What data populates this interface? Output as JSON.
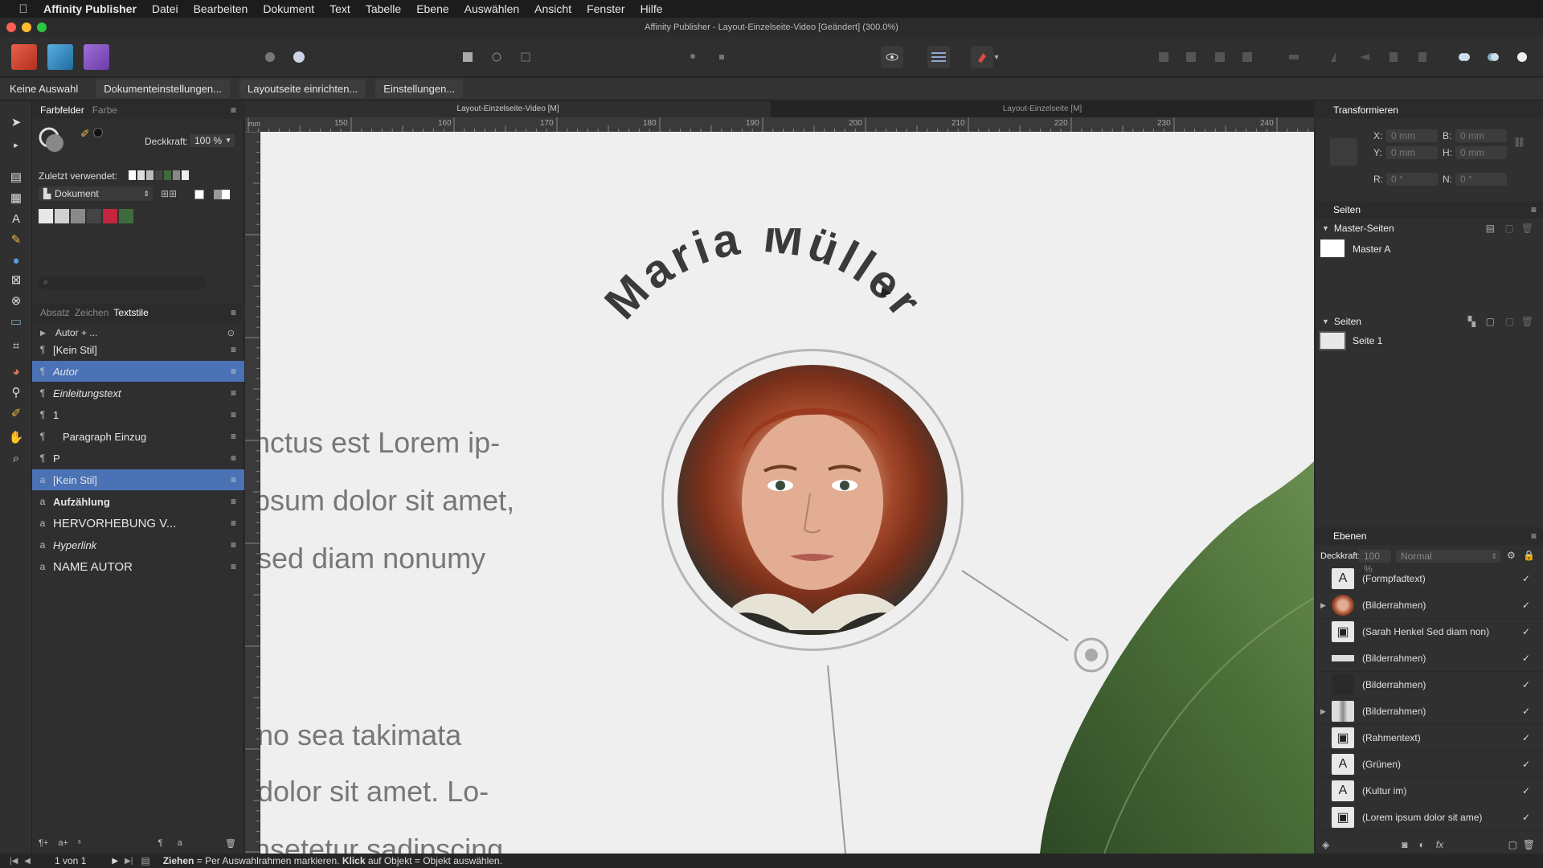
{
  "menubar": {
    "app_name": "Affinity Publisher",
    "items": [
      "Datei",
      "Bearbeiten",
      "Dokument",
      "Text",
      "Tabelle",
      "Ebene",
      "Auswählen",
      "Ansicht",
      "Fenster",
      "Hilfe"
    ]
  },
  "window_title": "Affinity Publisher - Layout-Einzelseite-Video [Geändert] (300.0%)",
  "context_bar": {
    "selection": "Keine Auswahl",
    "doc_settings": "Dokumenteinstellungen...",
    "layout_page": "Layoutseite einrichten...",
    "settings": "Einstellungen..."
  },
  "swatches_panel": {
    "tab_swatches": "Farbfelder",
    "tab_color": "Farbe",
    "opacity_label": "Deckkraft:",
    "opacity_value": "100 %",
    "recent_label": "Zuletzt verwendet:",
    "palette": "Dokument"
  },
  "text_styles_panel": {
    "tab_paragraph": "Absatz",
    "tab_character": "Zeichen",
    "tab_styles": "Textstile",
    "preview": "Autor + ...",
    "styles": [
      {
        "label": "[Kein Stil]",
        "type": "paragraph",
        "selected": false
      },
      {
        "label": "Autor",
        "type": "paragraph",
        "selected": true
      },
      {
        "label": "Einleitungstext",
        "type": "paragraph",
        "selected": false
      },
      {
        "label": "1",
        "type": "paragraph",
        "selected": false
      },
      {
        "label": "Paragraph Einzug",
        "type": "paragraph",
        "selected": false
      },
      {
        "label": "P",
        "type": "paragraph",
        "selected": false
      },
      {
        "label": "[Kein Stil]",
        "type": "character",
        "selected": true
      },
      {
        "label": "Aufzählung",
        "type": "character",
        "selected": false
      },
      {
        "label": "HERVORHEBUNG V...",
        "type": "character",
        "selected": false
      },
      {
        "label": "Hyperlink",
        "type": "character",
        "selected": false
      },
      {
        "label": "NAME AUTOR",
        "type": "character",
        "selected": false
      }
    ]
  },
  "document_tabs": [
    "Layout-Einzelseite-Video [M]",
    "Layout-Einzelseite [M]"
  ],
  "ruler_ticks": [
    "150",
    "160",
    "170",
    "180",
    "190",
    "200",
    "210",
    "220",
    "230",
    "240"
  ],
  "canvas": {
    "name_title": "Maria Müller",
    "text_lines": [
      "nctus est Lorem ip-",
      "psum dolor sit amet,",
      "sed diam nonumy",
      "no sea takimata",
      "dolor sit amet. Lo-",
      "nsetetur sadipscing"
    ]
  },
  "transform_panel": {
    "title": "Transformieren",
    "x_label": "X:",
    "x_value": "0 mm",
    "y_label": "Y:",
    "y_value": "0 mm",
    "b_label": "B:",
    "b_value": "0 mm",
    "h_label": "H:",
    "h_value": "0 mm",
    "r_label": "R:",
    "r_value": "0 °",
    "n_label": "N:",
    "n_value": "0 °"
  },
  "pages_panel": {
    "title": "Seiten",
    "master_section": "Master-Seiten",
    "master_item": "Master A",
    "pages_section": "Seiten",
    "page_item": "Seite 1"
  },
  "layers_panel": {
    "title": "Ebenen",
    "opacity_label": "Deckkraft:",
    "opacity_value": "100 %",
    "blend_mode": "Normal",
    "layers": [
      {
        "name": "(Formpfadtext)",
        "icon": "A",
        "expand": false
      },
      {
        "name": "(Bilderrahmen)",
        "icon": "portrait",
        "expand": true
      },
      {
        "name": "(Sarah Henkel Sed diam non)",
        "icon": "T",
        "expand": false
      },
      {
        "name": "(Bilderrahmen)",
        "icon": "bar",
        "expand": false
      },
      {
        "name": "(Bilderrahmen)",
        "icon": "dark",
        "expand": false
      },
      {
        "name": "(Bilderrahmen)",
        "icon": "figure",
        "expand": true
      },
      {
        "name": "(Rahmentext)",
        "icon": "T",
        "expand": false
      },
      {
        "name": "(Grünen)",
        "icon": "A",
        "expand": false
      },
      {
        "name": "(Kultur im)",
        "icon": "A",
        "expand": false
      },
      {
        "name": "(Lorem ipsum dolor sit ame)",
        "icon": "T",
        "expand": false
      }
    ]
  },
  "status_bar": {
    "page_indicator": "1 von 1",
    "hint_drag": "Ziehen",
    "hint_drag_text": " = Per Auswahlrahmen markieren. ",
    "hint_click": "Klick",
    "hint_click_text": " auf Objekt = Objekt auswählen."
  },
  "colors": {
    "selection_blue": "#4a72b5",
    "page_bg": "#efefef",
    "title_text": "#3a3a3a",
    "body_text": "#777777",
    "recent_swatch_red": "#c4243d",
    "recent_swatch_green": "#3e6b3e"
  }
}
